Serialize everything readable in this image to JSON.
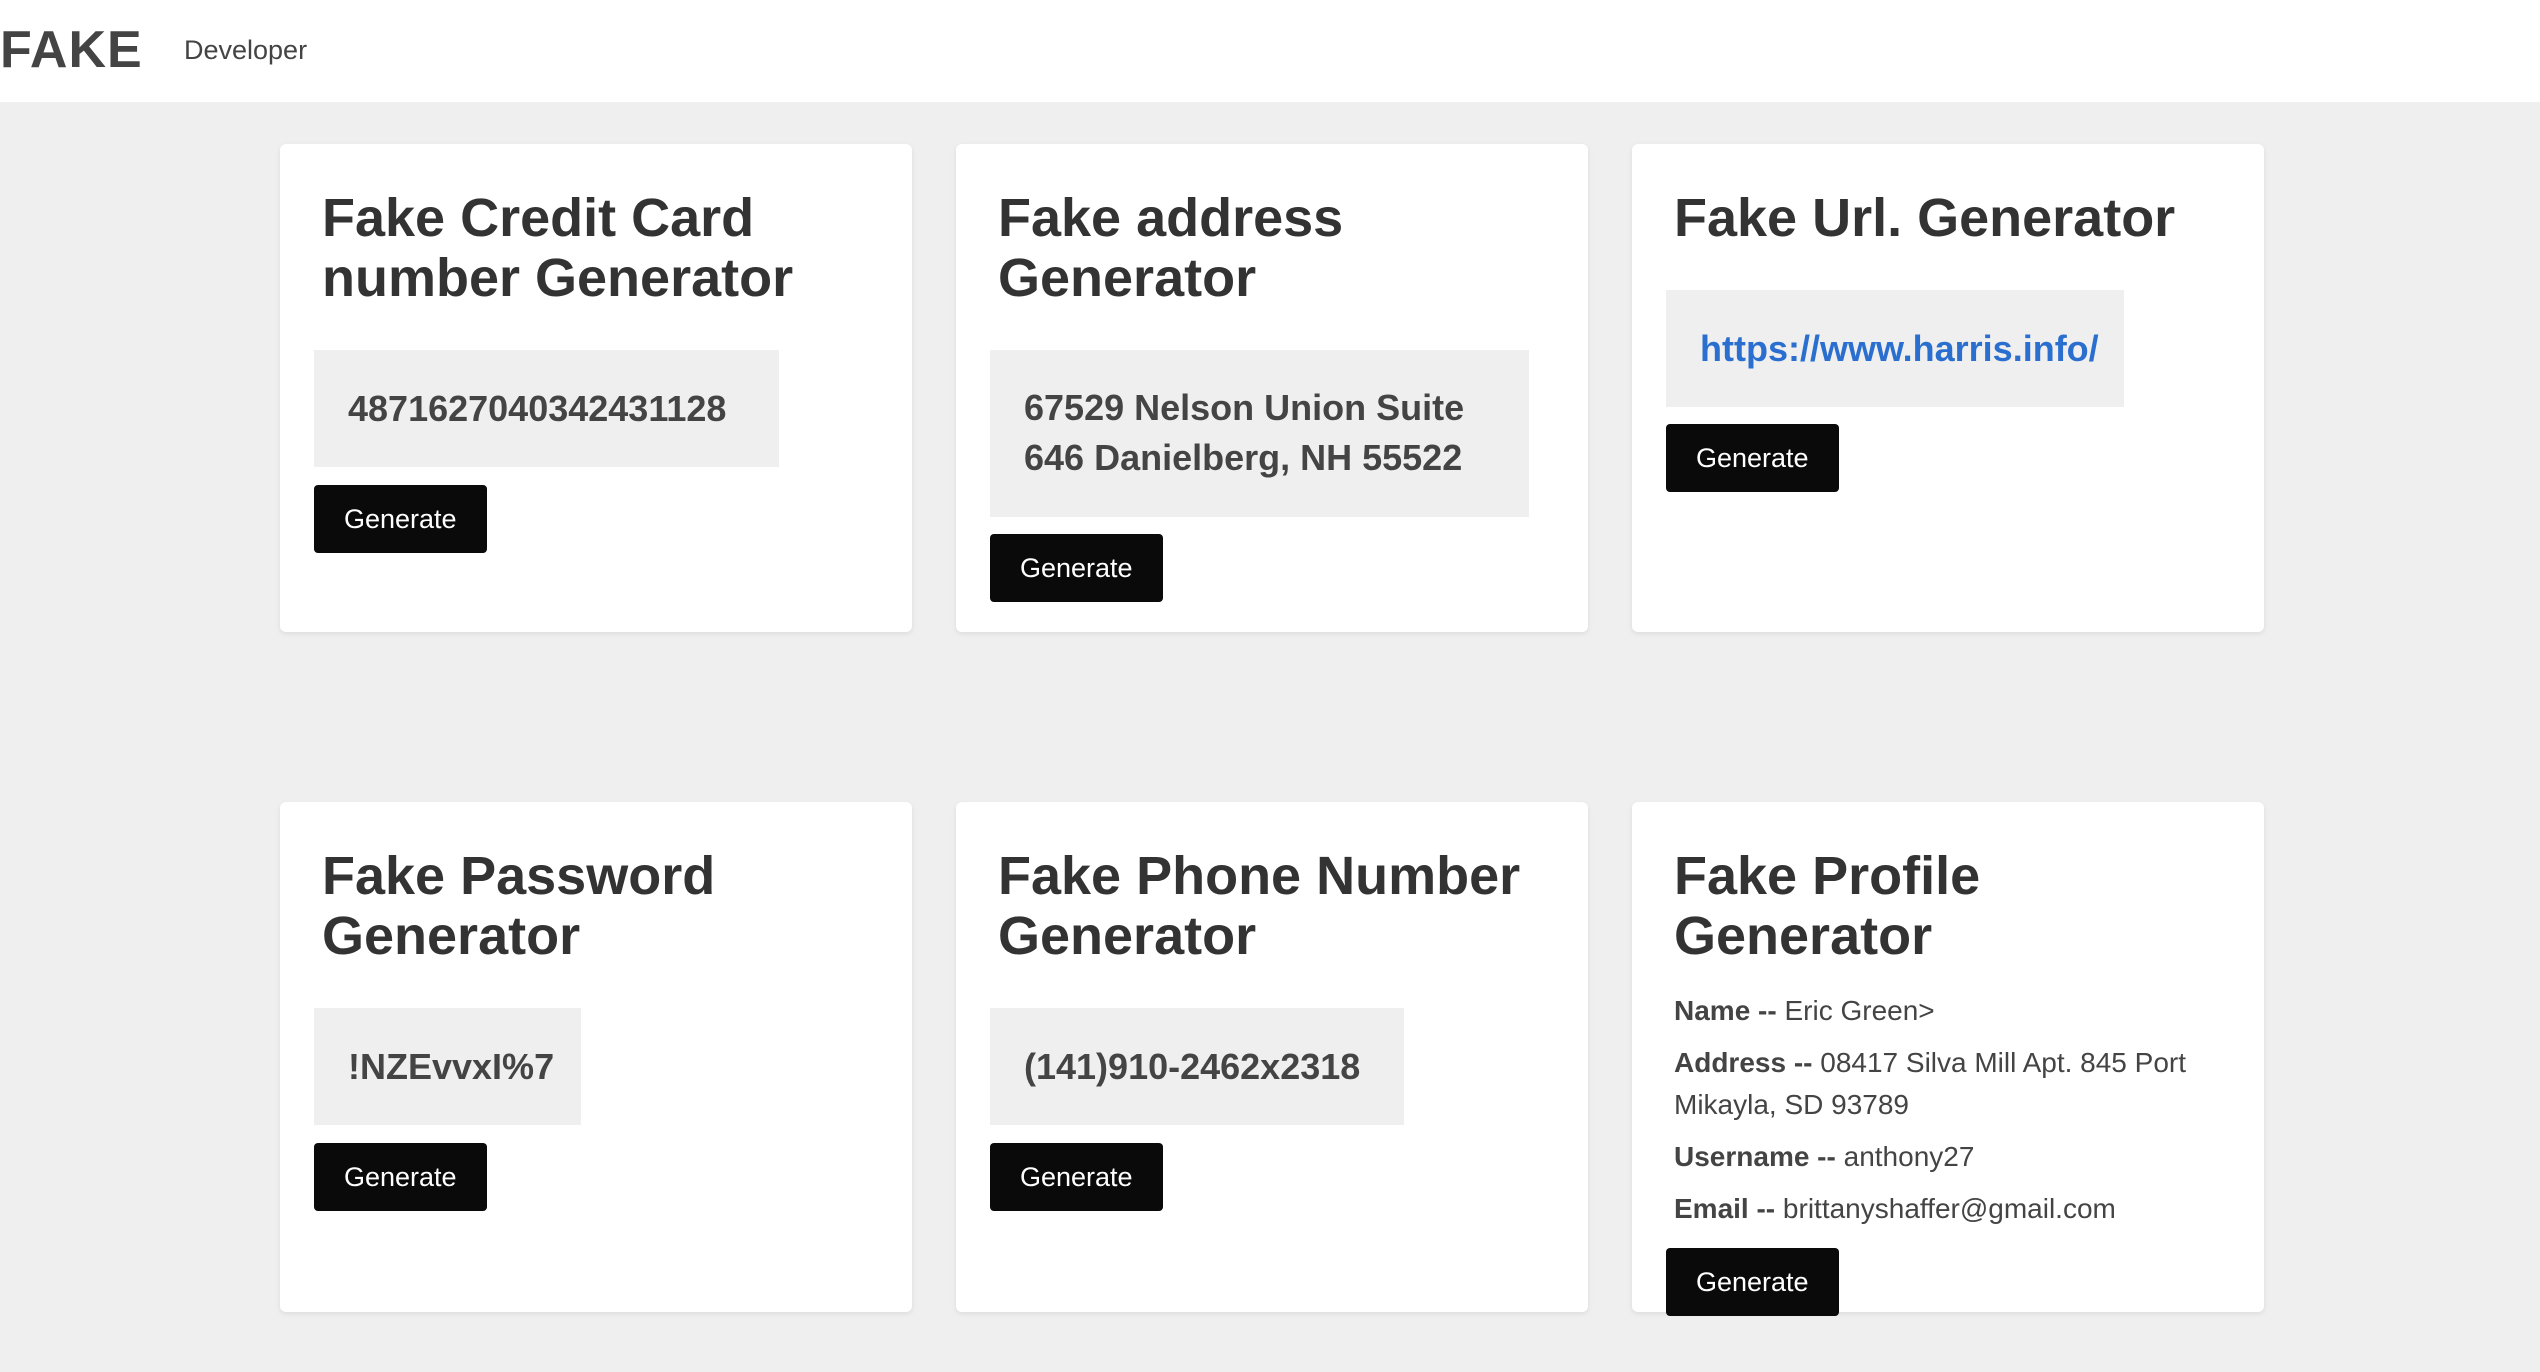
{
  "header": {
    "logo": "FAKE",
    "nav_link": "Developer"
  },
  "cards": {
    "credit_card": {
      "title": "Fake Credit Card number Generator",
      "value": "4871627040342431128",
      "button": "Generate"
    },
    "address": {
      "title": "Fake address Generator",
      "value": "67529 Nelson Union Suite 646 Danielberg, NH 55522",
      "button": "Generate"
    },
    "url": {
      "title": "Fake Url. Generator",
      "value": "https://www.harris.info/",
      "button": "Generate"
    },
    "password": {
      "title": "Fake Password Generator",
      "value": "!NZEvvxI%7",
      "button": "Generate"
    },
    "phone": {
      "title": "Fake Phone Number Generator",
      "value": "(141)910-2462x2318",
      "button": "Generate"
    },
    "profile": {
      "title": "Fake Profile Generator",
      "name_label": "Name --",
      "name_value": "Eric Green>",
      "address_label": "Address --",
      "address_value": "08417 Silva Mill Apt. 845 Port Mikayla, SD 93789",
      "username_label": "Username --",
      "username_value": "anthony27",
      "email_label": "Email --",
      "email_value": "brittanyshaffer@gmail.com",
      "button": "Generate"
    }
  },
  "colors": {
    "background": "#efefef",
    "card": "#ffffff",
    "button": "#0a0a0a",
    "link": "#2a6fcf"
  }
}
